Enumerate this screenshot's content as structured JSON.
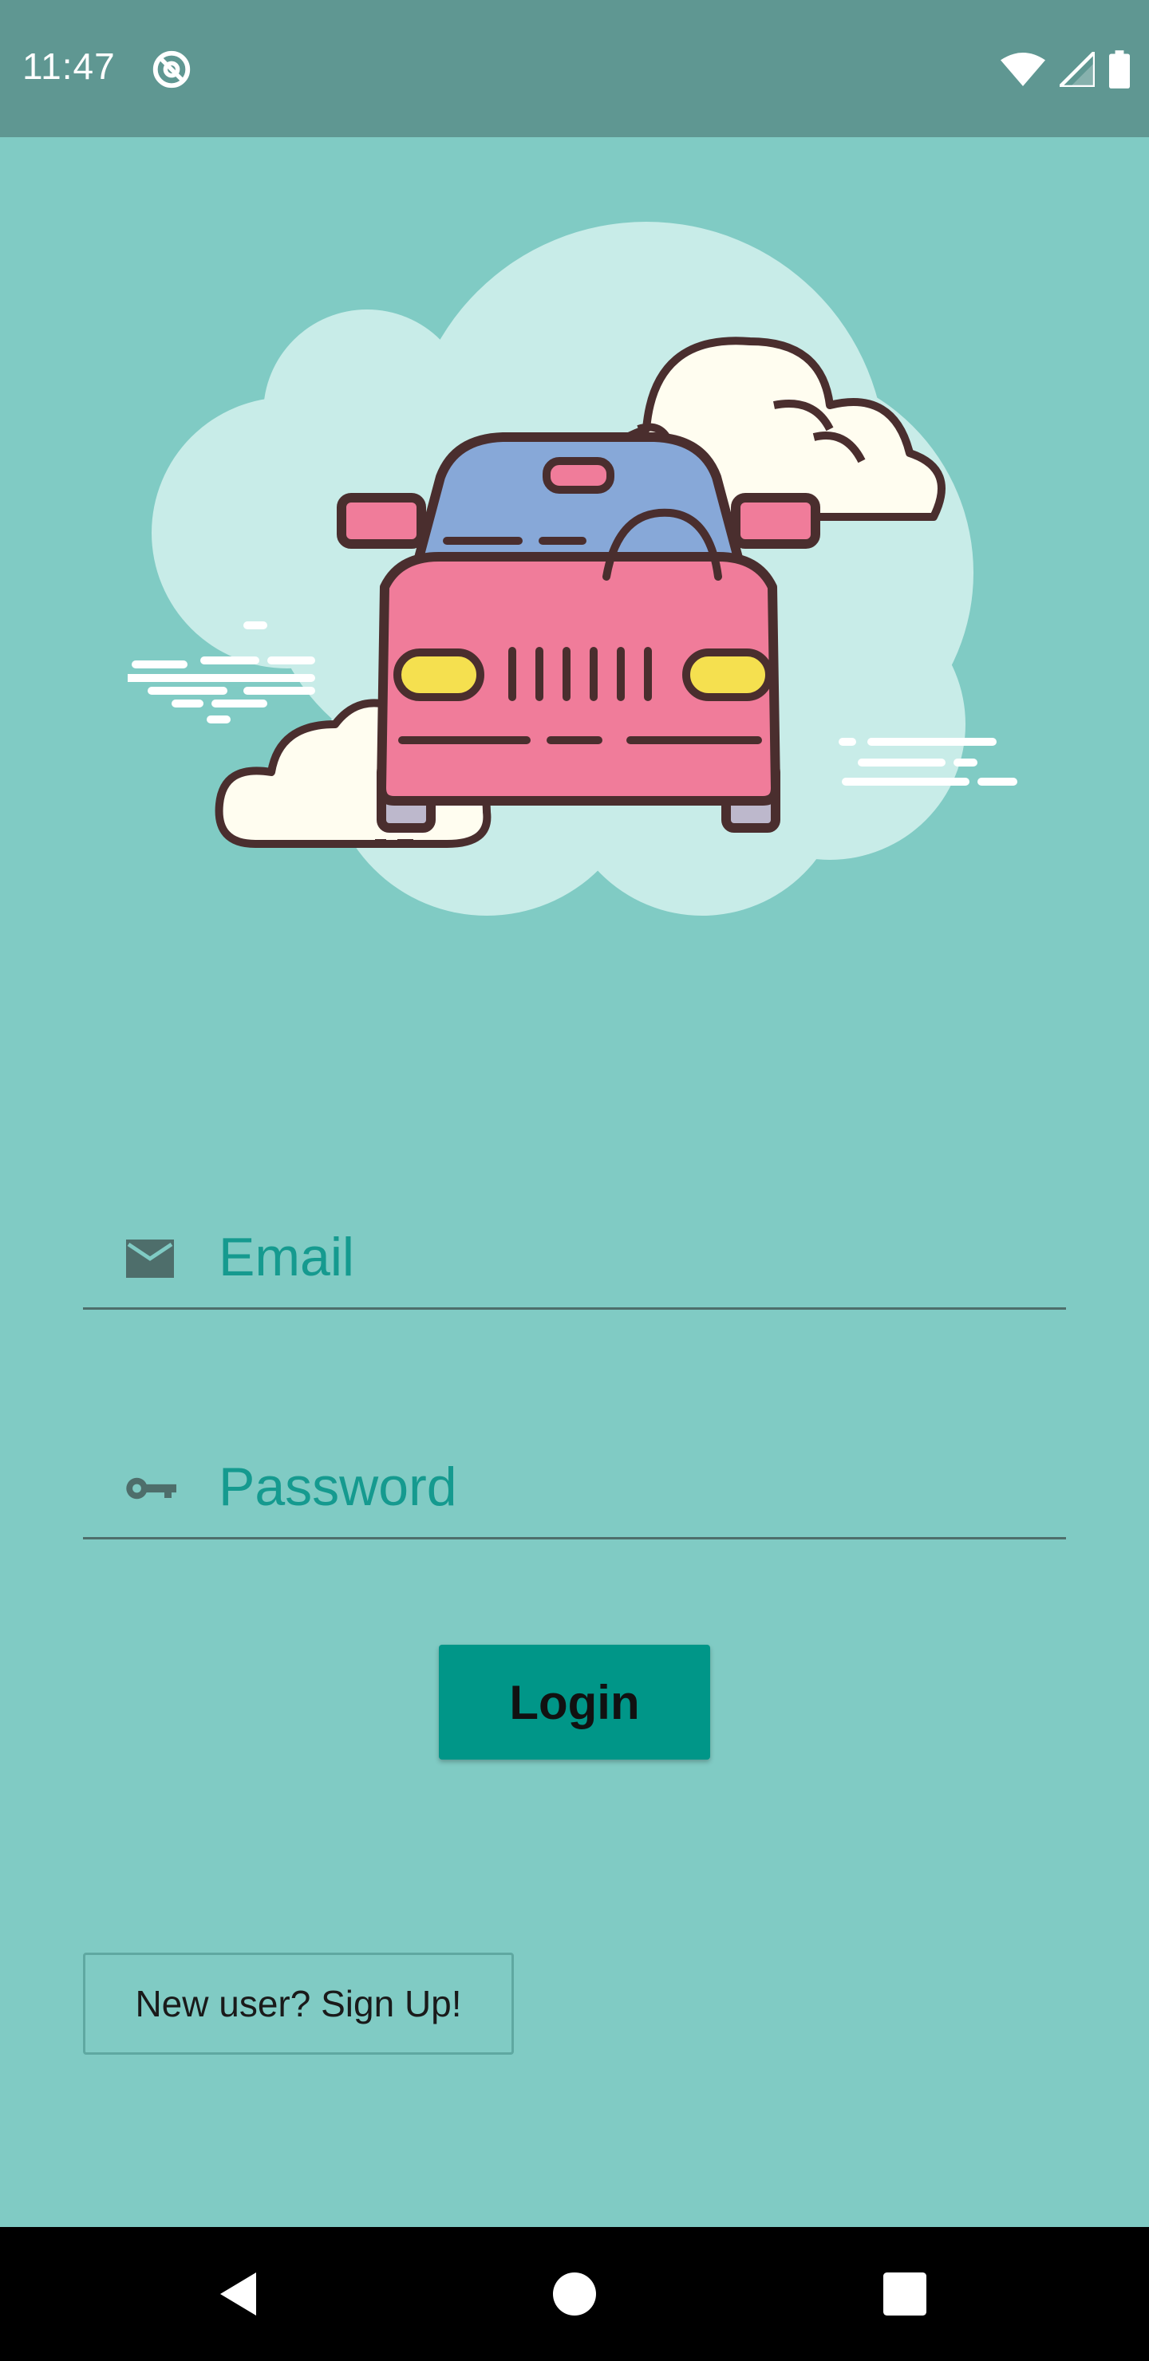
{
  "status_bar": {
    "time": "11:47",
    "left_icon": "do-not-disturb-icon",
    "right_icons": [
      "wifi-icon",
      "signal-icon",
      "battery-icon"
    ]
  },
  "hero": {
    "illustration": "car-in-clouds-illustration"
  },
  "form": {
    "email": {
      "placeholder": "Email",
      "icon": "mail-icon"
    },
    "password": {
      "placeholder": "Password",
      "icon": "key-icon"
    },
    "login_label": "Login",
    "signup_label": "New user? Sign Up!"
  },
  "nav": {
    "icons": [
      "back-icon",
      "home-icon",
      "recents-icon"
    ]
  },
  "colors": {
    "background": "#80CBC4",
    "status_bar": "#5F9792",
    "accent": "#009688",
    "placeholder": "#159A8F",
    "car_body": "#F07C9A",
    "car_window": "#87A8D8",
    "outline": "#4A2E2E",
    "cloud_bg": "#C8ECE8",
    "cloud_fg": "#FFFDF0"
  }
}
